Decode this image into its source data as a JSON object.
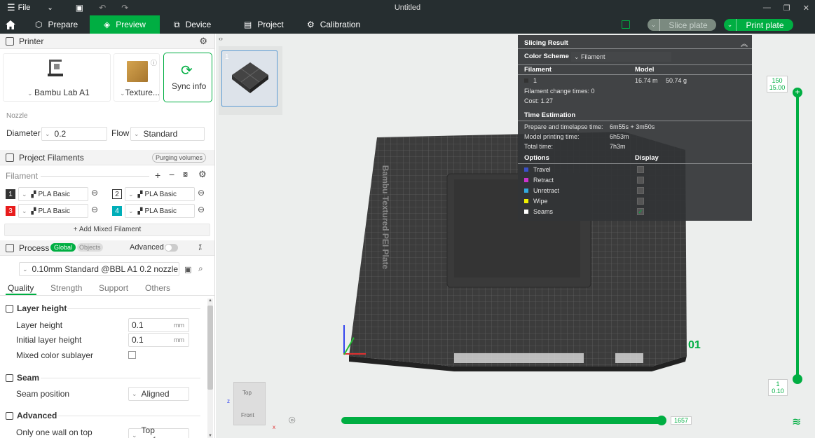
{
  "window": {
    "title": "Untitled",
    "file_menu": "File"
  },
  "tabs": [
    {
      "label": "Prepare"
    },
    {
      "label": "Preview"
    },
    {
      "label": "Device"
    },
    {
      "label": "Project"
    },
    {
      "label": "Calibration"
    }
  ],
  "toolbar": {
    "slice_label": "Slice plate",
    "print_label": "Print plate"
  },
  "printer": {
    "section_title": "Printer",
    "model": "Bambu Lab A1",
    "plate": "Texture...",
    "sync_label": "Sync info",
    "nozzle_label": "Nozzle",
    "diameter_label": "Diameter",
    "diameter_value": "0.2",
    "flow_label": "Flow",
    "flow_value": "Standard"
  },
  "filaments": {
    "section_title": "Project Filaments",
    "purging_label": "Purging volumes",
    "list_label": "Filament",
    "items": [
      {
        "num": "1",
        "name": "PLA Basic",
        "color": "#333333"
      },
      {
        "num": "2",
        "name": "PLA Basic",
        "color": "#ffffff"
      },
      {
        "num": "3",
        "name": "PLA Basic",
        "color": "#e81c1c"
      },
      {
        "num": "4",
        "name": "PLA Basic",
        "color": "#00aeb8"
      }
    ],
    "add_mixed": "+ Add Mixed Filament"
  },
  "process": {
    "section_title": "Process",
    "toggle_global": "Global",
    "toggle_objects": "Objects",
    "advanced_label": "Advanced",
    "profile": "0.10mm Standard @BBL A1 0.2 nozzle",
    "tabs": [
      "Quality",
      "Strength",
      "Support",
      "Others"
    ],
    "layer_height_group": "Layer height",
    "layer_height_label": "Layer height",
    "layer_height_value": "0.1",
    "initial_layer_label": "Initial layer height",
    "initial_layer_value": "0.1",
    "unit_mm": "mm",
    "mixed_sublayer_label": "Mixed color sublayer",
    "seam_group": "Seam",
    "seam_position_label": "Seam position",
    "seam_position_value": "Aligned",
    "advanced_group": "Advanced",
    "one_wall_label": "Only one wall on top",
    "one_wall_value": "Top surfaces"
  },
  "plate_thumb": {
    "number": "1"
  },
  "slicing_result": {
    "title": "Slicing Result",
    "color_scheme_label": "Color Scheme",
    "color_scheme_value": "Filament",
    "col_filament": "Filament",
    "col_model": "Model",
    "row_num": "1",
    "row_length": "16.74 m",
    "row_weight": "50.74 g",
    "change_times": "Filament change times:  0",
    "cost": "Cost:  1.27",
    "time_title": "Time Estimation",
    "prepare_label": "Prepare and timelapse time:",
    "prepare_value": "6m55s + 3m50s",
    "model_time_label": "Model printing time:",
    "model_time_value": "6h53m",
    "total_label": "Total time:",
    "total_value": "7h3m",
    "options_title": "Options",
    "display_title": "Display",
    "options": [
      {
        "label": "Travel",
        "color": "#3a50c8"
      },
      {
        "label": "Retract",
        "color": "#cc33cc"
      },
      {
        "label": "Unretract",
        "color": "#33aadd"
      },
      {
        "label": "Wipe",
        "color": "#f0f000"
      },
      {
        "label": "Seams",
        "color": "#ffffff"
      }
    ]
  },
  "sliders": {
    "top_layer": "150",
    "top_height": "15.00",
    "bottom_layer": "1",
    "bottom_height": "0.10",
    "moves": "1657"
  },
  "bed": {
    "brand_text": "Bambu Textured PEI Plate",
    "plate_number": "01"
  },
  "view_cube": {
    "top": "Top",
    "front": "Front"
  }
}
